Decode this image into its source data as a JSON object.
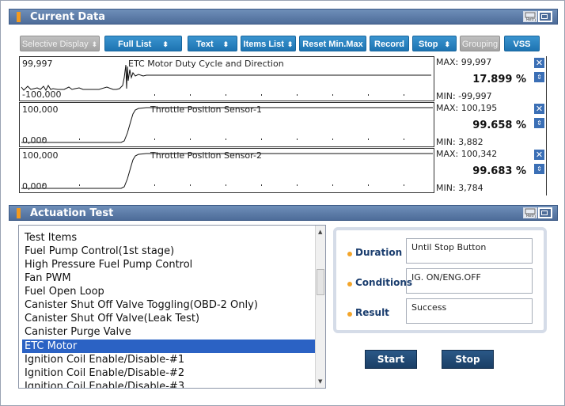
{
  "current_data": {
    "title": "Current Data",
    "toolbar": {
      "selective_display": "Selective Display",
      "full_list": "Full List",
      "text": "Text",
      "items_list": "Items List",
      "reset_min_max": "Reset Min.Max",
      "record": "Record",
      "stop": "Stop",
      "grouping": "Grouping",
      "vss": "VSS"
    },
    "graphs": [
      {
        "title": "ETC Motor Duty Cycle and Direction",
        "axis_max": "99,997",
        "axis_min": "-100,000",
        "max": "MAX: 99,997",
        "value": "17.899 %",
        "min": "MIN: -99,997"
      },
      {
        "title": "Throttle Position Sensor-1",
        "axis_max": "100,000",
        "axis_min": "0,000",
        "max": "MAX: 100,195",
        "value": "99.658 %",
        "min": "MIN: 3,882"
      },
      {
        "title": "Throttle Position Sensor-2",
        "axis_max": "100,000",
        "axis_min": "0,000",
        "max": "MAX: 100,342",
        "value": "99.683 %",
        "min": "MIN: 3,784"
      }
    ]
  },
  "actuation_test": {
    "title": "Actuation Test",
    "list_header": "Test Items",
    "items": [
      "Fuel Pump Control(1st stage)",
      "High Pressure Fuel Pump Control",
      "Fan PWM",
      "Fuel Open Loop",
      "Canister Shut Off Valve Toggling(OBD-2 Only)",
      "Canister Shut Off Valve(Leak Test)",
      "Canister Purge Valve",
      "ETC Motor",
      "Ignition Coil Enable/Disable-#1",
      "Ignition Coil Enable/Disable-#2",
      "Ignition Coil Enable/Disable-#3"
    ],
    "selected_index": 7,
    "duration_label": "Duration",
    "duration_value": "Until Stop Button",
    "conditions_label": "Conditions",
    "conditions_value": "IG. ON/ENG.OFF",
    "result_label": "Result",
    "result_value": "Success",
    "start_label": "Start",
    "stop_label": "Stop"
  },
  "icons": {
    "retry": "retry-icon",
    "window": "window-icon",
    "close": "close-icon",
    "scroll": "scroll-updown-icon"
  },
  "colors": {
    "header": "#4d6c99",
    "accent_orange": "#f39a1e",
    "toolbar_blue": "#1e74b2",
    "selection": "#2b62c4",
    "button_dark": "#1b3f66"
  }
}
